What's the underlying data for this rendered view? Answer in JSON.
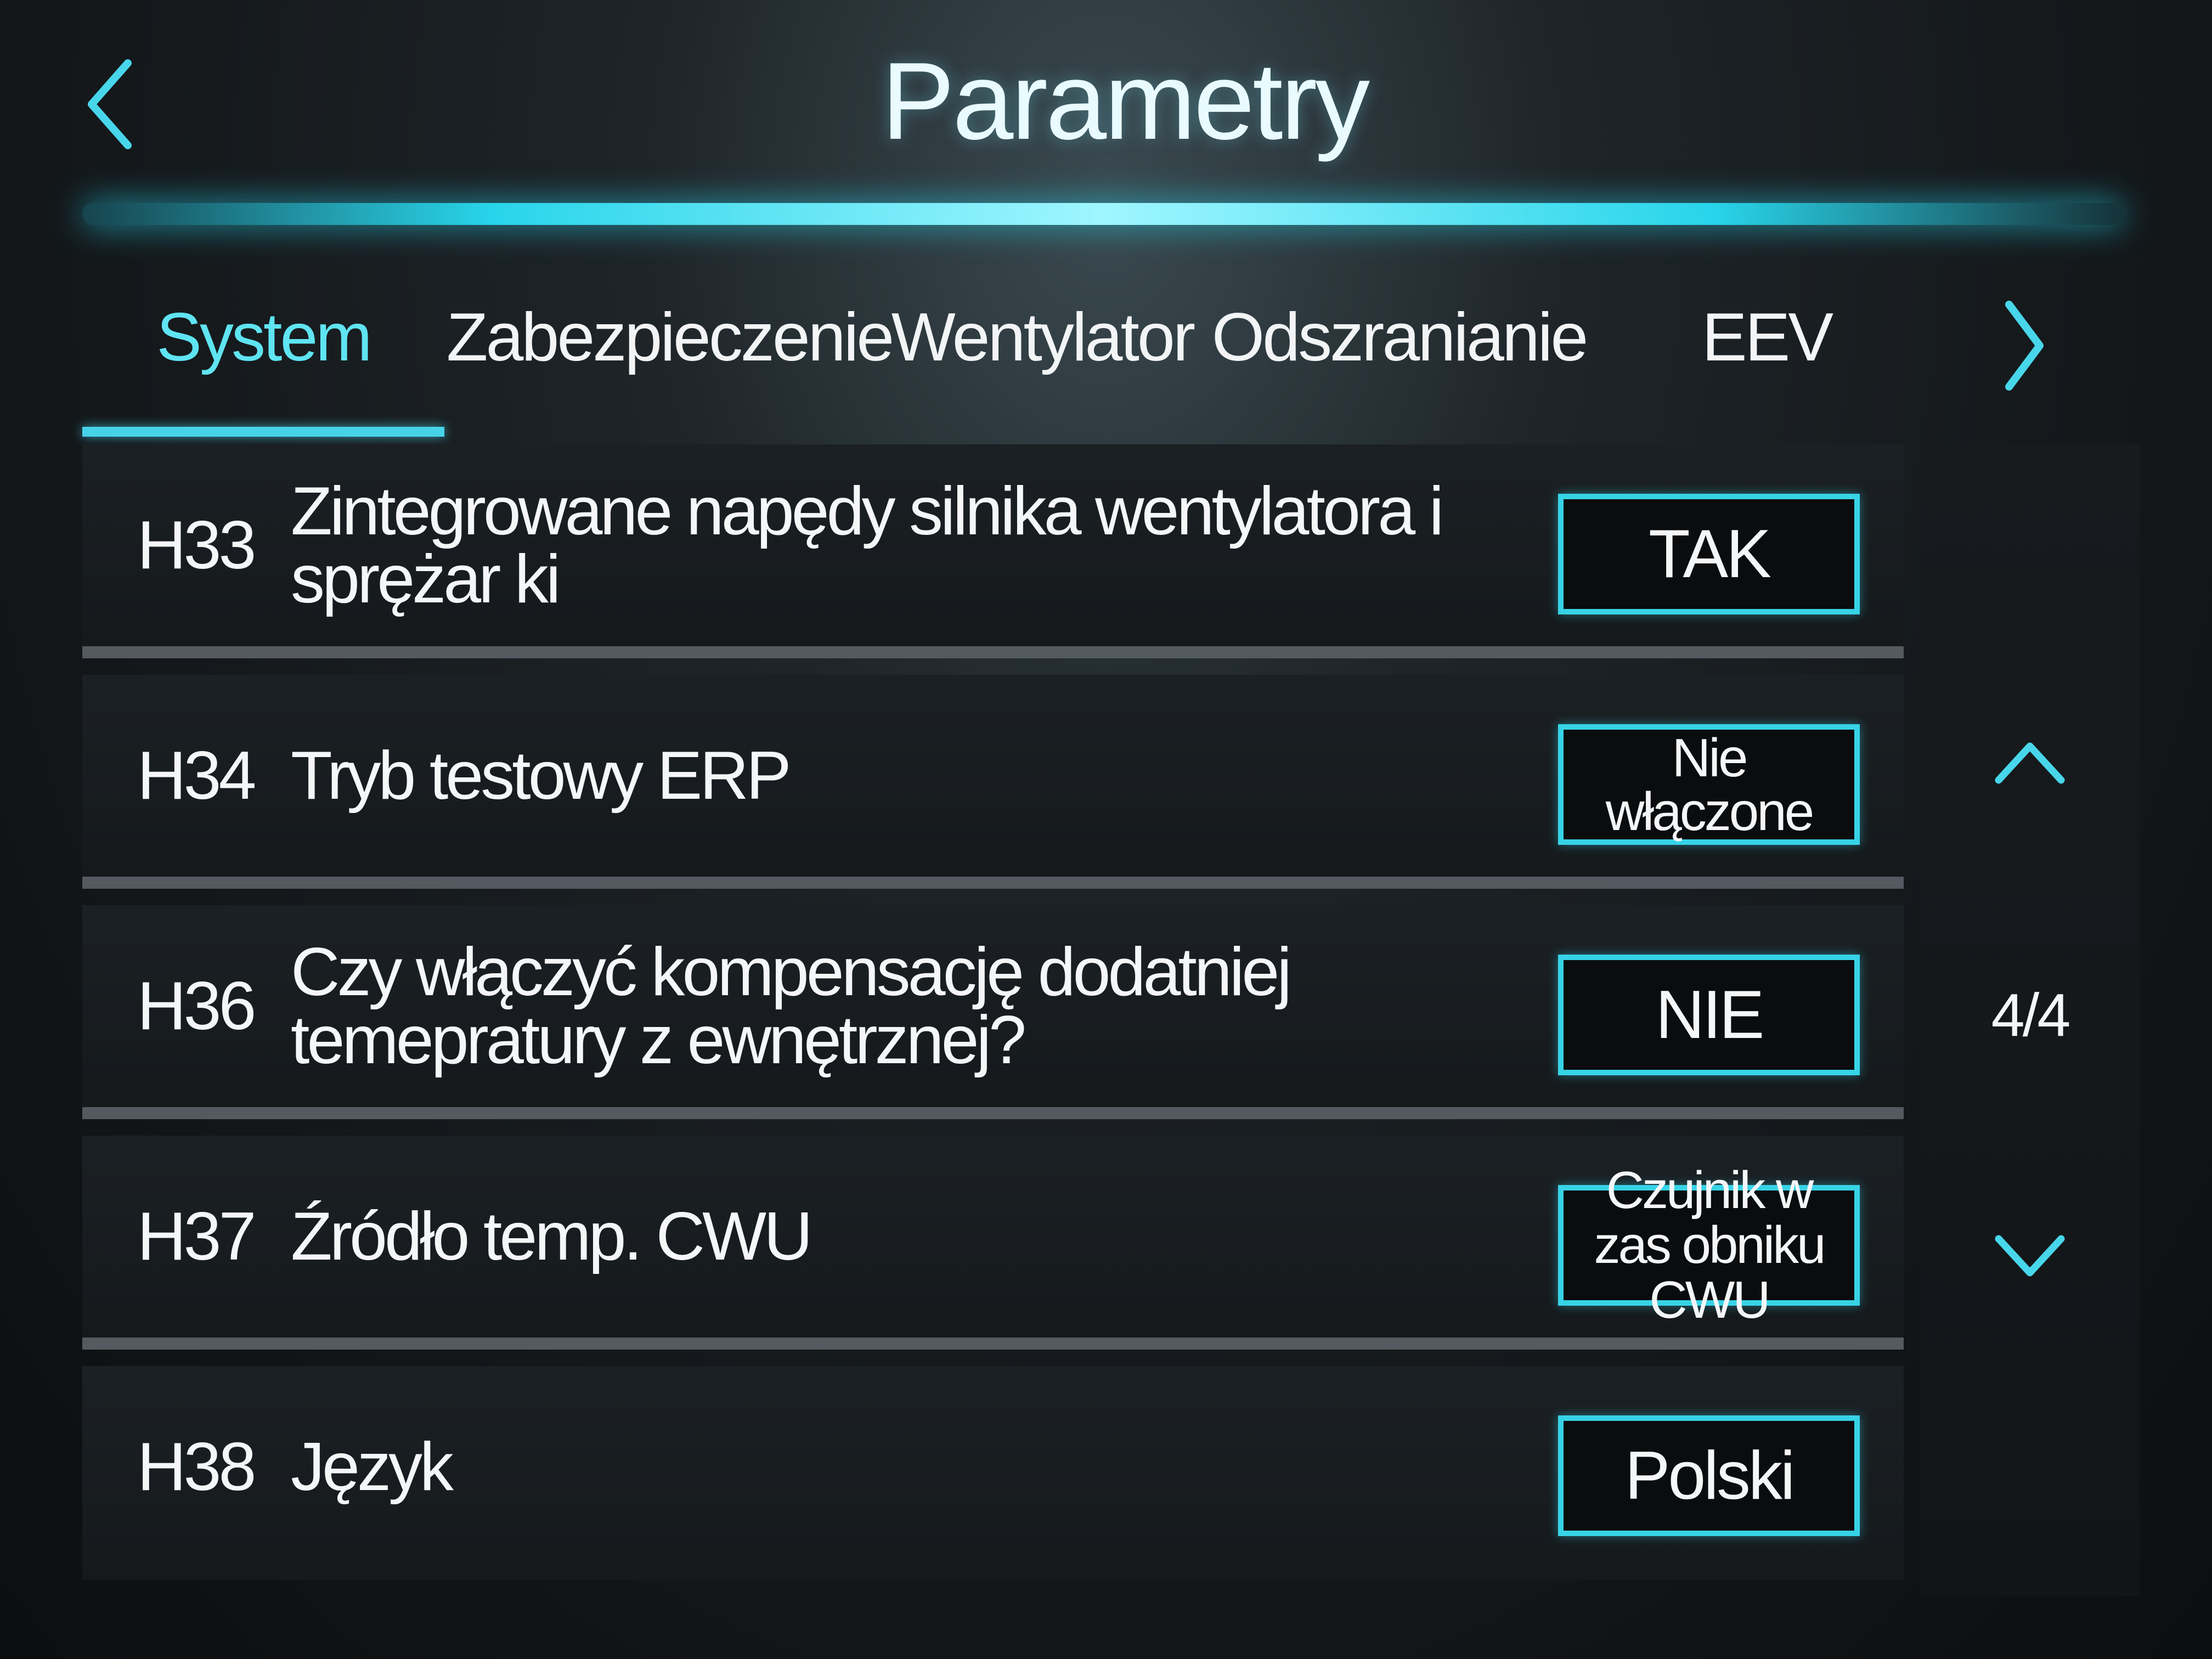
{
  "header": {
    "title": "Parametry",
    "back_icon": "chevron-left-icon"
  },
  "tabs": [
    {
      "label": "System",
      "active": true
    },
    {
      "label": "Zabezpieczenie",
      "active": false
    },
    {
      "label": "Wentylator",
      "active": false
    },
    {
      "label": "Odszranianie",
      "active": false
    },
    {
      "label": "EEV",
      "active": false
    }
  ],
  "tabs_next_icon": "chevron-right-icon",
  "parameters": [
    {
      "code": "H33",
      "label": "Zintegrowane napędy silnika wentylatora i sprężar ki",
      "value": "TAK"
    },
    {
      "code": "H34",
      "label": "Tryb testowy ERP",
      "value": "Nie włączone"
    },
    {
      "code": "H36",
      "label": "Czy włączyć kompensację dodatniej temepratury z ewnętrznej?",
      "value": "NIE"
    },
    {
      "code": "H37",
      "label": "Źródło temp. CWU",
      "value": "Czujnik w zas obniku CWU"
    },
    {
      "code": "H38",
      "label": "Język",
      "value": "Polski"
    }
  ],
  "pagination": {
    "indicator": "4/4",
    "up_icon": "chevron-up-icon",
    "down_icon": "chevron-down-icon"
  },
  "colors": {
    "accent": "#37d3e6",
    "active_tab": "#5fe4f2",
    "background": "#15191c",
    "divider": "#545a60"
  }
}
